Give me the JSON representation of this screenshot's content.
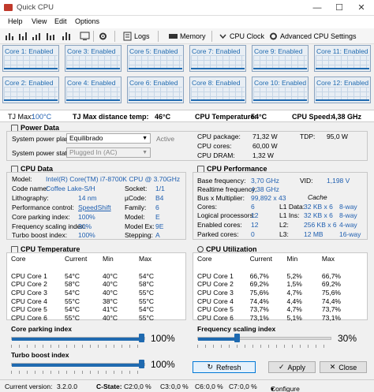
{
  "window": {
    "title": "Quick CPU"
  },
  "menu": [
    "Help",
    "View",
    "Edit",
    "Options"
  ],
  "toolbar": {
    "logs": "Logs",
    "memory": "Memory",
    "cpu_clock": "CPU Clock",
    "advanced": "Advanced CPU Settings"
  },
  "cores": [
    "Core 1: Enabled",
    "Core 3: Enabled",
    "Core 5: Enabled",
    "Core 7: Enabled",
    "Core 9: Enabled",
    "Core 11: Enabled",
    "Core 2: Enabled",
    "Core 4: Enabled",
    "Core 6: Enabled",
    "Core 8: Enabled",
    "Core 10: Enabled",
    "Core 12: Enabled"
  ],
  "status": {
    "tj_max_label": "TJ Max:",
    "tj_max": "100°C",
    "tj_dist_label": "TJ Max distance temp:",
    "tj_dist": "46°C",
    "cpu_temp_label": "CPU Temperature:",
    "cpu_temp": "54°C",
    "cpu_speed_label": "CPU Speed:",
    "cpu_speed": "4,38 GHz"
  },
  "power": {
    "title": "Power Data",
    "plan_label": "System power plan:",
    "plan_value": "Equilibrado",
    "plan_state": "Active",
    "state_label": "System power state:",
    "state_value": "Plugged In (AC)",
    "pkg_label": "CPU package:",
    "pkg": "71,32 W",
    "tdp_label": "TDP:",
    "tdp": "95,0 W",
    "cores_label": "CPU cores:",
    "cores": "60,00 W",
    "dram_label": "CPU DRAM:",
    "dram": "1,32 W"
  },
  "cpu": {
    "title": "CPU Data",
    "model_label": "Model:",
    "model": "Intel(R) Core(TM) i7-8700K CPU @ 3.70GHz",
    "codename_label": "Code name:",
    "codename": "Coffee Lake-S/H",
    "socket_label": "Socket:",
    "socket": "1/1",
    "litho_label": "Lithography:",
    "litho": "14 nm",
    "ucode_label": "µCode:",
    "ucode": "B4",
    "perf_label": "Performance control:",
    "perf": "SpeedShift",
    "family_label": "Family:",
    "family": "6",
    "parking_label": "Core parking index:",
    "parking": "100%",
    "modelnum_label": "Model:",
    "modelnum": "E",
    "freqidx_label": "Frequency scaling index:",
    "freqidx": "30%",
    "modelex_label": "Model Ex:",
    "modelex": "9E",
    "turbo_label": "Turbo boost index:",
    "turbo": "100%",
    "stepping_label": "Stepping:",
    "stepping": "A"
  },
  "perf": {
    "title": "CPU Performance",
    "base_label": "Base frequency:",
    "base": "3,70 GHz",
    "vid_label": "VID:",
    "vid": "1,198 V",
    "rt_label": "Realtime frequency:",
    "rt": "4,38 GHz",
    "mult_label": "Bus x Multiplier:",
    "mult": "99,892 x 43",
    "cache_label": "Cache",
    "cores_label": "Cores:",
    "cores": "6",
    "l1d_label": "L1 Data:",
    "l1d": "32 KB x 6",
    "l1d_way": "8-way",
    "lp_label": "Logical processors:",
    "lp": "12",
    "l1i_label": "L1 Ins:",
    "l1i": "32 KB x 6",
    "l1i_way": "8-way",
    "enabled_label": "Enabled cores:",
    "enabled": "12",
    "l2_label": "L2:",
    "l2": "256 KB x 6",
    "l2_way": "4-way",
    "parked_label": "Parked cores:",
    "parked": "0",
    "l3_label": "L3:",
    "l3": "12 MB",
    "l3_way": "16-way"
  },
  "temp": {
    "title": "CPU Temperature",
    "headers": [
      "Core",
      "Current",
      "Min",
      "Max"
    ],
    "rows": [
      [
        "CPU Core 1",
        "54°C",
        "40°C",
        "54°C"
      ],
      [
        "CPU Core 2",
        "58°C",
        "40°C",
        "58°C"
      ],
      [
        "CPU Core 3",
        "54°C",
        "40°C",
        "55°C"
      ],
      [
        "CPU Core 4",
        "55°C",
        "38°C",
        "55°C"
      ],
      [
        "CPU Core 5",
        "54°C",
        "41°C",
        "54°C"
      ],
      [
        "CPU Core 6",
        "55°C",
        "40°C",
        "55°C"
      ]
    ]
  },
  "util": {
    "title": "CPU Utilization",
    "headers": [
      "Core",
      "Current",
      "Min",
      "Max"
    ],
    "rows": [
      [
        "CPU Core 1",
        "66,7%",
        "5,2%",
        "66,7%"
      ],
      [
        "CPU Core 2",
        "69,2%",
        "1,5%",
        "69,2%"
      ],
      [
        "CPU Core 3",
        "75,6%",
        "4,7%",
        "75,6%"
      ],
      [
        "CPU Core 4",
        "74,4%",
        "4,4%",
        "74,4%"
      ],
      [
        "CPU Core 5",
        "73,7%",
        "4,7%",
        "73,7%"
      ],
      [
        "CPU Core 6",
        "73,1%",
        "5,1%",
        "73,1%"
      ]
    ]
  },
  "sliders": {
    "parking_label": "Core parking index",
    "parking": "100%",
    "parking_level": 1.0,
    "freq_label": "Frequency scaling index",
    "freq": "30%",
    "freq_level": 0.3,
    "turbo_label": "Turbo boost index",
    "turbo": "100%",
    "turbo_level": 1.0
  },
  "buttons": {
    "refresh": "Refresh",
    "apply": "Apply",
    "close": "Close"
  },
  "footer": {
    "version_label": "Current version:",
    "version": "3.2.0.0",
    "cstate_label": "C-State:",
    "c2_label": "C2:",
    "c2": "0,0 %",
    "c3_label": "C3:",
    "c3": "0,0 %",
    "c6_label": "C6:",
    "c6": "0,0 %",
    "c7_label": "C7:",
    "c7": "0,0 %",
    "configure": "Configure"
  }
}
